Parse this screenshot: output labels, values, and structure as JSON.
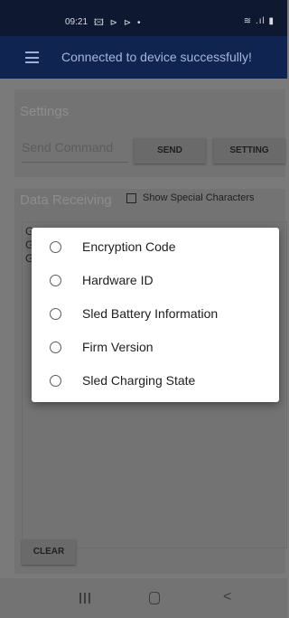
{
  "status_bar": {
    "time": "09:21",
    "notification_icons": "🖾 ⊳ ⊳ •",
    "system_icons": "≋ .ıl ▮"
  },
  "app_bar": {
    "title": "Connected to device successfully!"
  },
  "settings_card": {
    "title": "Settings",
    "command_placeholder": "Send Command",
    "send_label": "SEND",
    "setting_label": "SETTING"
  },
  "data_card": {
    "title": "Data Receiving",
    "checkbox_label": "Show Special Characters",
    "checkbox_checked": false,
    "received_lines": [
      "G",
      "G",
      "G"
    ],
    "clear_label": "CLEAR"
  },
  "dialog": {
    "options": [
      {
        "label": "Encryption Code",
        "selected": false
      },
      {
        "label": "Hardware ID",
        "selected": false
      },
      {
        "label": "Sled Battery Information",
        "selected": false
      },
      {
        "label": "Firm Version",
        "selected": false
      },
      {
        "label": "Sled Charging State",
        "selected": false
      }
    ]
  },
  "nav_bar": {
    "back_glyph": "<"
  },
  "colors": {
    "app_bar": "#0f2450",
    "status_bar": "#0e1830",
    "scrim_background": "#7a7a7a",
    "dialog_background": "#ffffff"
  }
}
